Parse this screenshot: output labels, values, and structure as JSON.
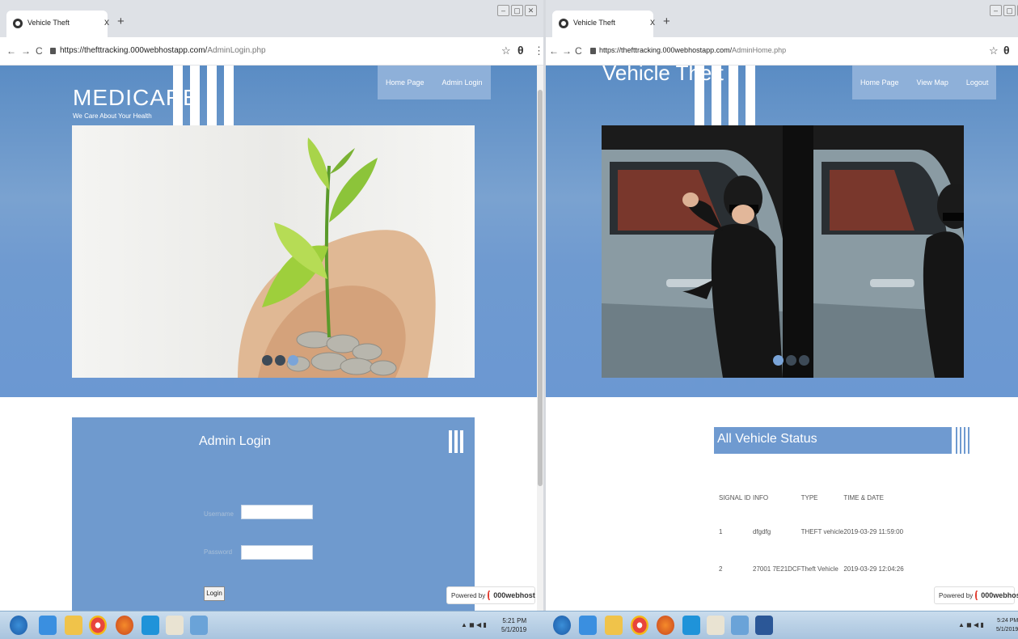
{
  "left_window": {
    "tab_title": "Vehicle Theft",
    "url_host": "https://thefttracking.000webhostapp.com/",
    "url_path": "AdminLogin.php",
    "nav": [
      "Home Page",
      "Admin Login"
    ],
    "brand_name": "MEDICARE",
    "brand_tagline": "We Care About Your Health",
    "login": {
      "heading": "Admin Login",
      "username_label": "Username",
      "password_label": "Password",
      "button_label": "Login"
    },
    "powered": {
      "prefix": "Powered by",
      "brand": "000webhost"
    }
  },
  "right_window": {
    "tab_title": "Vehicle Theft",
    "url_host": "https://thefttracking.000webhostapp.com/",
    "url_path": "AdminHome.php",
    "nav": [
      "Home Page",
      "View Map",
      "Logout"
    ],
    "site_title": "Vehicle Theft",
    "status_heading": "All Vehicle Status",
    "table": {
      "headers": [
        "SIGNAL ID",
        "INFO",
        "TYPE",
        "TIME & DATE"
      ],
      "rows": [
        [
          "1",
          "dfgdfg",
          "THEFT vehicle",
          "2019-03-29 11:59:00"
        ],
        [
          "2",
          "27001 7E21DCF",
          "Theft Vehicle",
          "2019-03-29 12:04:26"
        ]
      ]
    },
    "powered": {
      "prefix": "Powered by",
      "brand": "000webhost"
    }
  },
  "chrome": {
    "tab_close": "x",
    "new_tab": "+",
    "back": "←",
    "forward": "→",
    "reload": "C",
    "star": "☆",
    "account": "θ",
    "menu": "⋮",
    "win_min": "–",
    "win_max": "▢",
    "win_close": "✕"
  },
  "taskbar": {
    "left_clock_time": "5:21 PM",
    "left_clock_date": "5/1/2019",
    "right_clock_time": "5:24 PM",
    "right_clock_date": "5/1/2019",
    "icons": [
      "windows-start-icon",
      "ie-icon",
      "folder-icon",
      "chrome-icon",
      "firefox-icon",
      "skype-icon",
      "paint-icon",
      "photo-viewer-icon"
    ],
    "accent": "#a9c4de"
  },
  "colors": {
    "hero_blue": "#6b98d2",
    "nav_blue": "#8eb0d9",
    "panel_blue": "#6f9ace"
  }
}
